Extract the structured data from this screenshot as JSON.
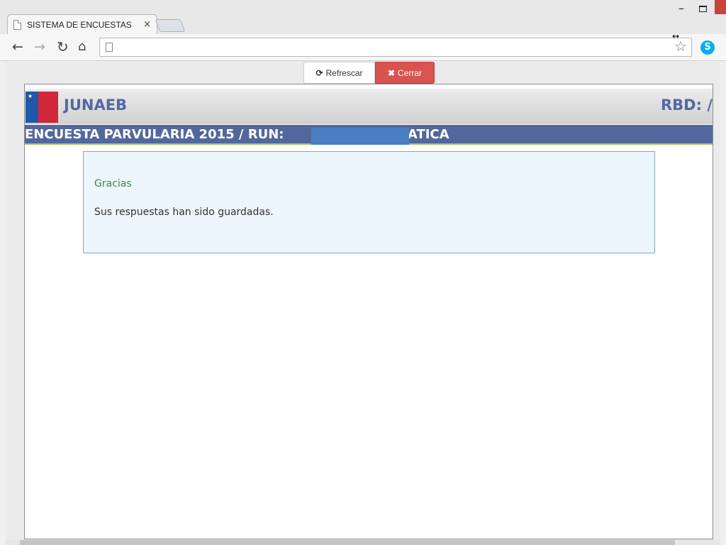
{
  "browser": {
    "tab_title": "SISTEMA DE ENCUESTAS -",
    "tab_close": "×",
    "address_value": "",
    "icons": {
      "back": "arrow-left-icon",
      "forward": "arrow-right-icon",
      "reload": "reload-icon",
      "home": "home-icon",
      "star": "star-icon",
      "skype": "skype-icon"
    },
    "back_glyph": "←",
    "forward_glyph": "→",
    "reload_glyph": "↻",
    "home_glyph": "⌂",
    "star_glyph": "☆",
    "skype_glyph": "S",
    "min_glyph": "–",
    "resize_glyph": "↔"
  },
  "actions": {
    "refresh_icon": "⟳",
    "refresh_label": "Refrescar",
    "close_icon": "✖",
    "close_label": "Cerrar"
  },
  "header": {
    "brand": "JUNAEB",
    "rbd": "RBD: /"
  },
  "survey": {
    "title": "ENCUESTA PARVULARIA 2015 / RUN:                  SOF GATICA"
  },
  "message": {
    "heading": "Gracias",
    "text": "Sus respuestas han sido guardadas."
  },
  "colors": {
    "accent_blue": "#52679b",
    "brand_text": "#5468a4",
    "close_button": "#d9534f",
    "success_text": "#3c8a3a",
    "message_bg": "#edf5fd"
  }
}
